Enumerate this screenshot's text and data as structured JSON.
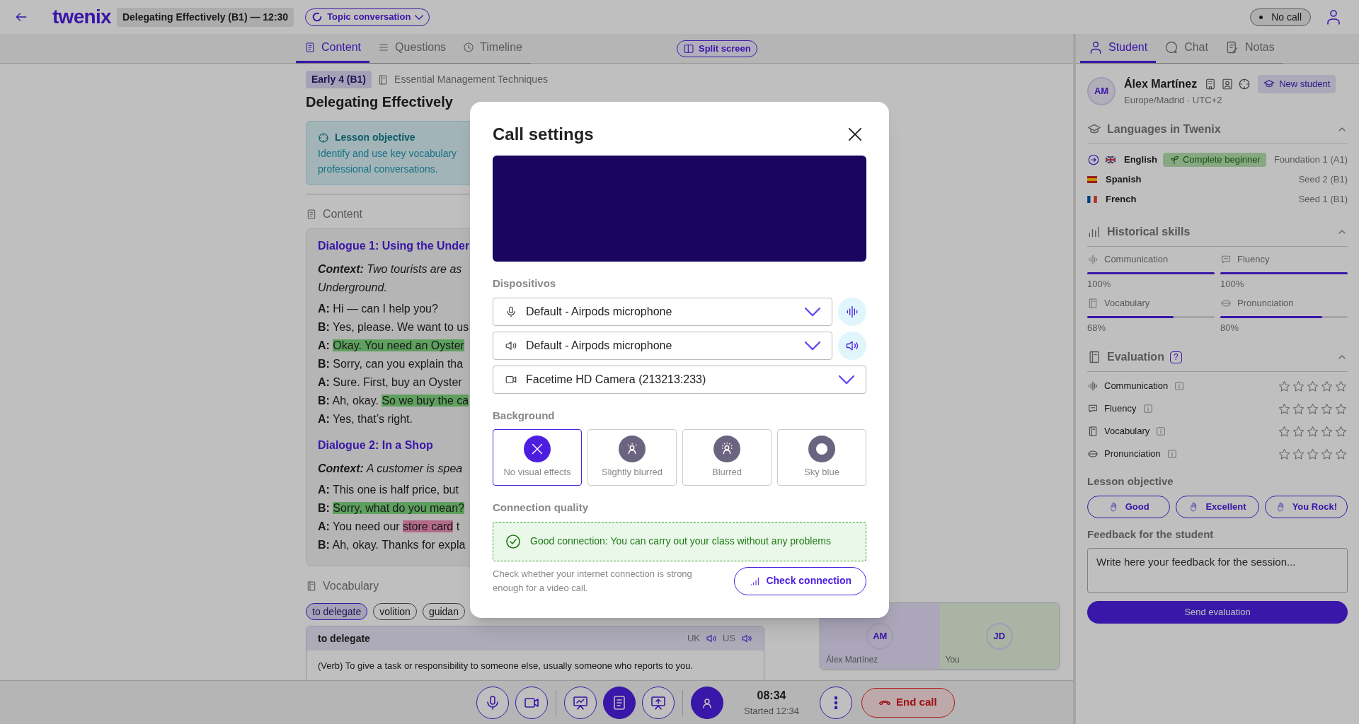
{
  "top_bar": {
    "logo": "twenix",
    "lesson": "Delegating Effectively (B1) — 12:30",
    "mode": "Topic conversation",
    "call_status": "No call"
  },
  "content_tabs": [
    {
      "label": "Content",
      "selected": true
    },
    {
      "label": "Questions",
      "selected": false
    },
    {
      "label": "Timeline",
      "selected": false
    }
  ],
  "split_screen": "Split screen",
  "lesson": {
    "level": "Early 4 (B1)",
    "course": "Essential Management Techniques",
    "title": "Delegating Effectively",
    "objective": {
      "heading": "Lesson objective",
      "lines": [
        "Identify and use key vocabulary",
        "professional conversations."
      ]
    },
    "section": "Content",
    "dialogues": [
      {
        "title": "Dialogue 1: Using the Under",
        "context": [
          "**Context:** Two tourists are as",
          "Underground."
        ],
        "lines": [
          {
            "speaker": "A:",
            "parts": [
              {
                "text": "Hi — can I help you?",
                "kind": "plain"
              }
            ]
          },
          {
            "speaker": "B:",
            "parts": [
              {
                "text": "Yes, please. We want to us",
                "kind": "plain"
              }
            ]
          },
          {
            "speaker": "A:",
            "parts": [
              {
                "text": "Okay. You need an Oyster",
                "kind": "highlight"
              }
            ]
          },
          {
            "speaker": "B:",
            "parts": [
              {
                "text": "Sorry, can you explain tha",
                "kind": "plain"
              }
            ]
          },
          {
            "speaker": "A:",
            "parts": [
              {
                "text": "Sure. First, buy an Oyster",
                "kind": "plain"
              }
            ]
          },
          {
            "speaker": "B:",
            "parts": [
              {
                "text": "Ah, okay. ",
                "kind": "plain"
              },
              {
                "text": "So we buy the ca",
                "kind": "highlight"
              }
            ]
          },
          {
            "speaker": "A:",
            "parts": [
              {
                "text": "Yes, that’s right.",
                "kind": "plain"
              }
            ]
          }
        ]
      },
      {
        "title": "Dialogue 2: In a Shop",
        "context": [
          "**Context:** A customer is spea"
        ],
        "lines": [
          {
            "speaker": "A:",
            "parts": [
              {
                "text": "This one is half price, but",
                "kind": "plain"
              }
            ]
          },
          {
            "speaker": "B:",
            "parts": [
              {
                "text": "Sorry, what do you mean?",
                "kind": "highlight"
              }
            ]
          },
          {
            "speaker": "A:",
            "parts": [
              {
                "text": "You need our ",
                "kind": "plain"
              },
              {
                "text": "store card",
                "kind": "term"
              },
              {
                "text": " t",
                "kind": "plain"
              }
            ]
          },
          {
            "speaker": "B:",
            "parts": [
              {
                "text": "Ah, okay. Thanks for expla",
                "kind": "plain"
              }
            ]
          }
        ]
      }
    ],
    "vocabulary": {
      "heading": "Vocabulary",
      "chips": [
        {
          "label": "to delegate",
          "selected": true
        },
        {
          "label": "volition",
          "selected": false
        },
        {
          "label": "guidan",
          "selected": false
        }
      ],
      "card": {
        "term": "to delegate",
        "accents": [
          "UK",
          "US"
        ],
        "definition": "(Verb) To give a task or responsibility to someone else, usually someone who reports to you."
      }
    }
  },
  "video_tile": [
    {
      "initials": "AM",
      "name": "Álex Martínez"
    },
    {
      "initials": "JD",
      "name": "You"
    }
  ],
  "call_controls": [
    {
      "selected": false
    },
    {
      "selected": false
    },
    {
      "selected": false
    },
    {
      "selected": true
    },
    {
      "selected": false
    },
    {
      "selected": true
    }
  ],
  "call_time": {
    "elapsed": "08:34",
    "started": "Started 12:34"
  },
  "end_call": "End call",
  "modal": {
    "title": "Call settings",
    "devices_label": "Dispositivos",
    "devices": [
      {
        "kind": "microphone",
        "value": "Default - Airpods microphone"
      },
      {
        "kind": "speaker",
        "value": "Default - Airpods microphone"
      },
      {
        "kind": "camera",
        "value": "Facetime HD Camera (213213:233)"
      }
    ],
    "background_label": "Background",
    "backgrounds": [
      {
        "label": "No visual effects",
        "selected": true
      },
      {
        "label": "Slightly blurred",
        "selected": false
      },
      {
        "label": "Blurred",
        "selected": false
      },
      {
        "label": "Sky blue",
        "selected": false
      }
    ],
    "connection_label": "Connection quality",
    "connection": {
      "kind": "good",
      "message": "Good connection: You can carry out your class without any problems"
    },
    "hint": "Check whether your internet connection is strong enough for a video call.",
    "check_button": "Check connection"
  },
  "side_tabs": [
    {
      "label": "Student",
      "selected": true
    },
    {
      "label": "Chat",
      "selected": false
    },
    {
      "label": "Notas",
      "selected": false
    }
  ],
  "student": {
    "initials": "AM",
    "name": "Álex Martínez",
    "timezone": "Europe/Madrid · UTC+2",
    "badge": "New student"
  },
  "languages": {
    "heading": "Languages in Twenix",
    "expanded": true,
    "items": [
      {
        "kind": "uk",
        "name": "English",
        "current": true,
        "tag": "Complete beginner",
        "level": "Foundation 1 (A1)"
      },
      {
        "kind": "es",
        "name": "Spanish",
        "current": false,
        "level": "Seed 2 (B1)"
      },
      {
        "kind": "fr",
        "name": "French",
        "current": false,
        "level": "Seed 1 (B1)"
      }
    ]
  },
  "skills": {
    "heading": "Historical skills",
    "expanded": true,
    "items": [
      {
        "name": "Communication",
        "level": 1,
        "value": "100%"
      },
      {
        "name": "Fluency",
        "level": 1,
        "value": "100%"
      },
      {
        "name": "Vocabulary",
        "level": 0.68,
        "value": "68%"
      },
      {
        "name": "Pronunciation",
        "level": 0.8,
        "value": "80%"
      }
    ]
  },
  "evaluation": {
    "heading": "Evaluation",
    "help": "?",
    "expanded": true,
    "criteria": [
      {
        "name": "Communication",
        "stars": 0
      },
      {
        "name": "Fluency",
        "stars": 0
      },
      {
        "name": "Vocabulary",
        "stars": 0
      },
      {
        "name": "Pronunciation",
        "stars": 0
      }
    ]
  },
  "objective_label": "Lesson objective",
  "objective_options": [
    {
      "label": "Good",
      "selected": false
    },
    {
      "label": "Excellent",
      "selected": false
    },
    {
      "label": "You Rock!",
      "selected": false
    }
  ],
  "feedback": {
    "label": "Feedback for the student",
    "placeholder": "Write here your feedback for the session...",
    "send": "Send evaluation"
  }
}
